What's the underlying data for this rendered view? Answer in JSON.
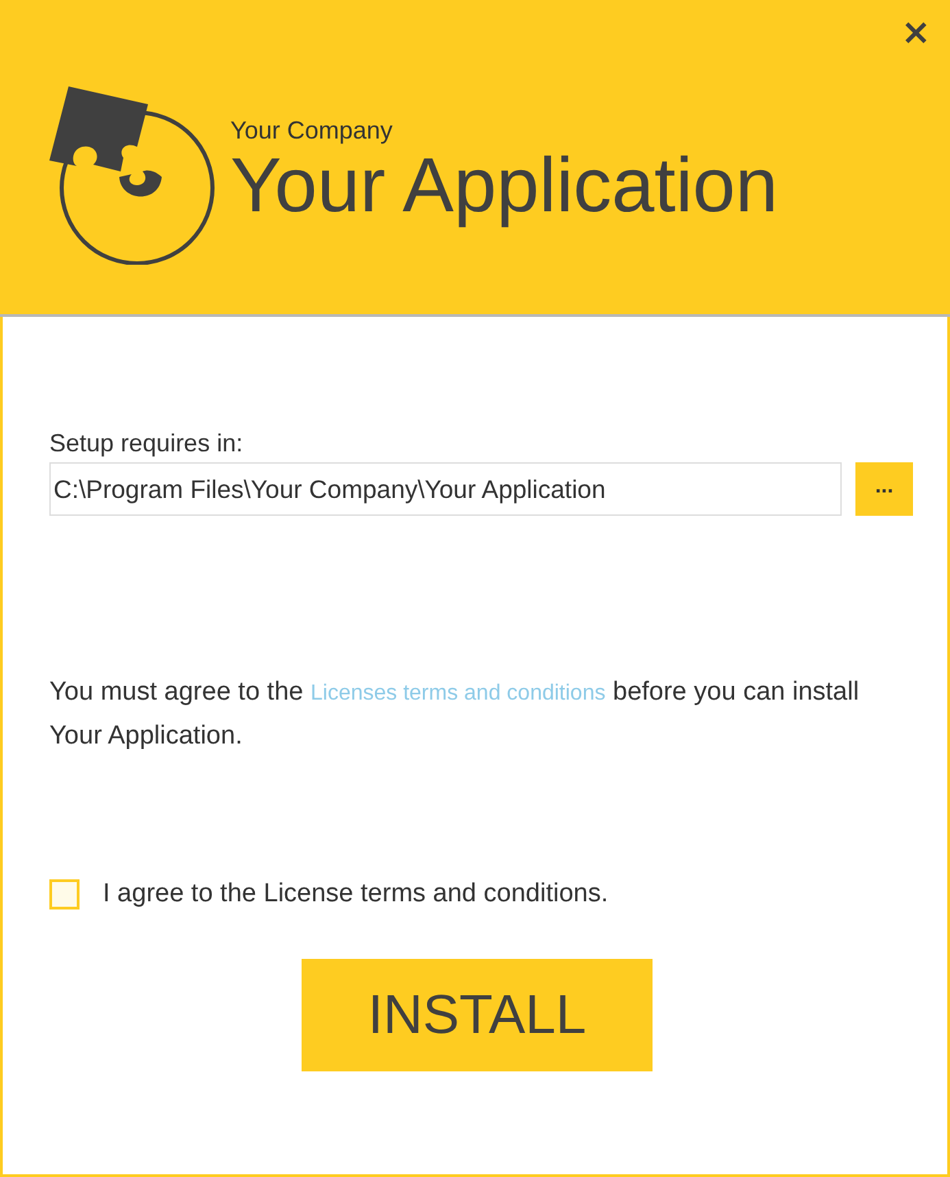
{
  "header": {
    "close": "×",
    "company": "Your Company",
    "title": "Your Application"
  },
  "install_location": {
    "label": "Setup requires in:",
    "value": "C:\\Program Files\\Your Company\\Your Application",
    "browse": "..."
  },
  "notice": {
    "before": "You must agree to the ",
    "link": "Licenses terms and conditions",
    "after": " before you can install Your Application."
  },
  "agreement": {
    "label": "I agree to the License terms and conditions.",
    "checked": false
  },
  "install_button": "INSTALL"
}
